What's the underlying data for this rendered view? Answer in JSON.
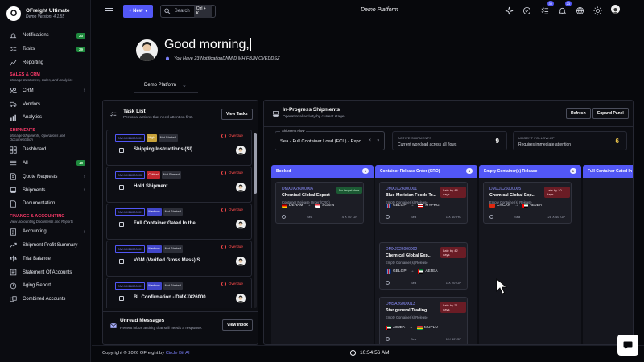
{
  "app": {
    "name": "OFreight Ultimate",
    "version": "Demo Version: 4.1.55",
    "logo_letter": "O"
  },
  "topbar": {
    "new_label": "+ New",
    "search_placeholder": "Search",
    "search_shortcut": "Ctrl + K",
    "title": "Demo Platform",
    "badge_tasks": "30",
    "badge_notifications": "23"
  },
  "sidebar": {
    "top": [
      {
        "label": "Notifications",
        "badge": "23",
        "icon": "bell-icon"
      },
      {
        "label": "Tasks",
        "badge": "29",
        "icon": "tasks-icon"
      },
      {
        "label": "Reporting",
        "icon": "chart-icon"
      }
    ],
    "sales": {
      "title": "SALES & CRM",
      "subtitle": "Manage Customers, Sales, and Analytics",
      "items": [
        {
          "label": "CRM",
          "icon": "crm-icon",
          "chevron": "›"
        },
        {
          "label": "Vendors",
          "icon": "truck-icon"
        },
        {
          "label": "Analytics",
          "icon": "analytics-icon"
        }
      ]
    },
    "shipments": {
      "title": "SHIPMENTS",
      "subtitle": "Manage Shipments, Operations and Documentation",
      "items": [
        {
          "label": "Dashboard",
          "icon": "dashboard-icon"
        },
        {
          "label": "All",
          "badge": "16",
          "icon": "list-icon"
        },
        {
          "label": "Quote Requests",
          "icon": "quote-icon",
          "chevron": "›"
        },
        {
          "label": "Shipments",
          "icon": "ship-icon",
          "chevron": "›"
        },
        {
          "label": "Documentation",
          "icon": "doc-icon"
        }
      ]
    },
    "finance": {
      "title": "FINANCE & ACCOUNTING",
      "subtitle": "View Accounting Documents and Reports",
      "items": [
        {
          "label": "Accounting",
          "icon": "accounting-icon",
          "chevron": "›"
        },
        {
          "label": "Shipment Profit Summary",
          "icon": "profit-icon"
        },
        {
          "label": "Trial Balance",
          "icon": "balance-icon"
        },
        {
          "label": "Statement Of Accounts",
          "icon": "statement-icon"
        },
        {
          "label": "Aging Report",
          "icon": "aging-icon"
        },
        {
          "label": "Combined Accounts",
          "icon": "combined-icon"
        }
      ]
    }
  },
  "greeting": {
    "title": "Good morning,",
    "subtitle": "You Have 23 NotificationDNM D MH FBJN CVEDDSZ",
    "platform_select": "Demo Platform"
  },
  "task_panel": {
    "title": "Task List",
    "subtitle": "Personal actions that need attention first.",
    "view_button": "View Tasks",
    "tasks": [
      {
        "id": "DMXJX26000001",
        "priority": "High",
        "priority_color": "#c8a23a",
        "status": "Not Started",
        "due": "Overdue",
        "name": "Shipping Instructions (SI) ..."
      },
      {
        "id": "DMXJX26000002",
        "priority": "Critical",
        "priority_color": "#c0262f",
        "status": "Not Started",
        "due": "Overdue",
        "name": "Hold Shipment"
      },
      {
        "id": "DMXJX26000001",
        "priority": "Medium",
        "priority_color": "#4146c9",
        "status": "Not Started",
        "due": "Overdue",
        "name": "Full Container Gated In the..."
      },
      {
        "id": "DMXJX26000001",
        "priority": "Medium",
        "priority_color": "#4146c9",
        "status": "Not Started",
        "due": "Overdue",
        "name": "VGM (Verified Gross Mass) S..."
      },
      {
        "id": "DMXJX26000001",
        "priority": "Medium",
        "priority_color": "#4146c9",
        "status": "Not Started",
        "due": "Overdue",
        "name": "BL Confirmation - DMXJX26000..."
      }
    ],
    "unread_title": "Unread Messages",
    "unread_subtitle": "Recent inbox activity that still needs a response.",
    "inbox_button": "View Inbox"
  },
  "ship_panel": {
    "title": "In-Progress Shipments",
    "subtitle": "Operational activity by current stage",
    "refresh": "Refresh",
    "expand": "Expand Panel",
    "flow_label": "Shipment Flow",
    "flow_value": "Sea - Full Container Load (FCL) - Expo...",
    "flow_clear": "×",
    "flow_arrow": "▾",
    "active": {
      "label": "ACTIVE SHIPMENTS",
      "desc": "Current workload across all flows",
      "value": "9",
      "color": "#ffffff"
    },
    "urgent": {
      "label": "URGENT FOLLOW-UP",
      "desc": "Requires immediate attention",
      "value": "6",
      "color": "#f2c94c"
    },
    "columns": [
      {
        "title": "Booked",
        "count": "1",
        "cards": [
          {
            "id": "DMXJX26000006",
            "name": "Chemical Global Export",
            "type": "Container Release Order (CRO)",
            "badge": "No target date",
            "badge_kind": "green",
            "from": "DEHAM",
            "from_flag": "de",
            "to": "SGSIN",
            "to_flag": "sg",
            "mode": "Sea",
            "ctr": "4 X 40' GP"
          }
        ]
      },
      {
        "title": "Container Release Order (CRO)",
        "count": "3",
        "cards": [
          {
            "id": "DMXJX26000001",
            "name": "Blue Meridian Foods Tr...",
            "type": "Empty Container(s) Release",
            "badge": "Late by 48 days",
            "badge_kind": "red",
            "from": "GBLGP",
            "from_flag": "gb",
            "to": "MYPKG",
            "to_flag": "my",
            "mode": "Sea",
            "ctr": "1 X 40' HC"
          },
          {
            "id": "DMXJX26000002",
            "name": "Chemical Global Exp...",
            "type": "Empty Container(s) Release",
            "badge": "Late by 42 days",
            "badge_kind": "red",
            "from": "GBLGP",
            "from_flag": "gb",
            "to": "AEJEA",
            "to_flag": "ae",
            "mode": "Sea",
            "ctr": "1 X 20' GP"
          },
          {
            "id": "DMSA26000013",
            "name": "Star general Trading",
            "type": "Empty Container(s) Release",
            "badge": "Late by 21 days",
            "badge_kind": "red",
            "from": "AEJEA",
            "from_flag": "ae",
            "to": "MUPLU",
            "to_flag": "mu",
            "mode": "Sea",
            "ctr": "1 X 40' GP"
          }
        ]
      },
      {
        "title": "Empty Container(s) Release",
        "count": "1",
        "cards": [
          {
            "id": "DMXJX26000005",
            "name": "Chemical Global Exp...",
            "type": "Empty Container(s) Release",
            "badge": "Late by 10 days",
            "badge_kind": "red",
            "from": "CNCAN",
            "from_flag": "cn",
            "to": "AEJEA",
            "to_flag": "ae",
            "mode": "Sea",
            "ctr": "2a X 40' GP"
          }
        ]
      },
      {
        "title": "Full Container Gated In",
        "count": "",
        "cards": []
      }
    ]
  },
  "footer": {
    "copyright": "Copyright © 2026 OFreight by ",
    "company": "Circle Bit AI",
    "time": "10:54:56 AM"
  }
}
